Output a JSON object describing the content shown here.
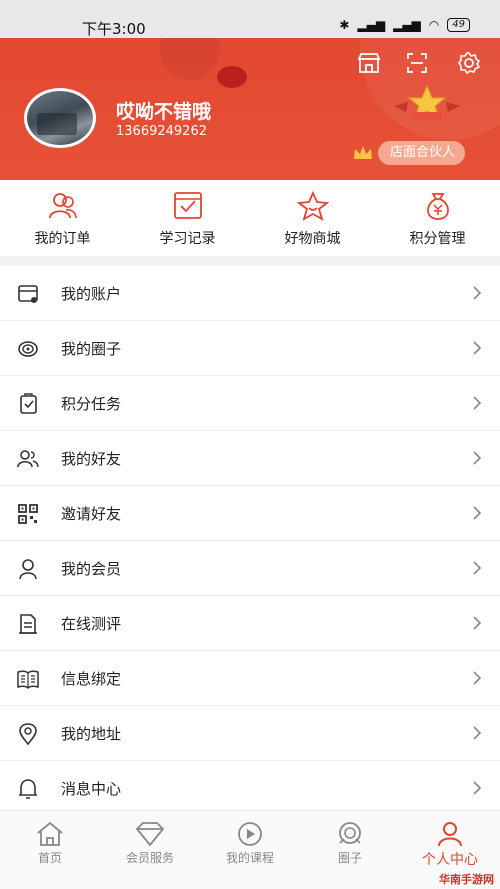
{
  "status": {
    "time": "下午3:00",
    "battery": "49"
  },
  "profile": {
    "name": "哎呦不错哦",
    "phone": "13669249262",
    "partner_label": "店面合伙人"
  },
  "quick_menu": [
    {
      "label": "我的订单",
      "icon": "orders-icon"
    },
    {
      "label": "学习记录",
      "icon": "study-record-icon"
    },
    {
      "label": "好物商城",
      "icon": "mall-star-icon"
    },
    {
      "label": "积分管理",
      "icon": "points-bag-icon"
    }
  ],
  "menu": [
    {
      "label": "我的账户",
      "icon": "account-card-icon"
    },
    {
      "label": "我的圈子",
      "icon": "circle-icon"
    },
    {
      "label": "积分任务",
      "icon": "task-clipboard-icon"
    },
    {
      "label": "我的好友",
      "icon": "friends-icon"
    },
    {
      "label": "邀请好友",
      "icon": "qrcode-icon"
    },
    {
      "label": "我的会员",
      "icon": "member-icon"
    },
    {
      "label": "在线测评",
      "icon": "evaluate-icon"
    },
    {
      "label": "信息绑定",
      "icon": "bind-book-icon"
    },
    {
      "label": "我的地址",
      "icon": "location-pin-icon"
    },
    {
      "label": "消息中心",
      "icon": "bell-icon"
    }
  ],
  "tabs": [
    {
      "label": "首页",
      "icon": "home-icon"
    },
    {
      "label": "会员服务",
      "icon": "diamond-icon"
    },
    {
      "label": "我的课程",
      "icon": "play-icon"
    },
    {
      "label": "圈子",
      "icon": "circle-tab-icon"
    },
    {
      "label": "个人中心",
      "icon": "person-icon",
      "active": true
    }
  ],
  "watermark": "华南手游网",
  "colors": {
    "brand": "#e2452e",
    "pill": "#f6a890"
  }
}
